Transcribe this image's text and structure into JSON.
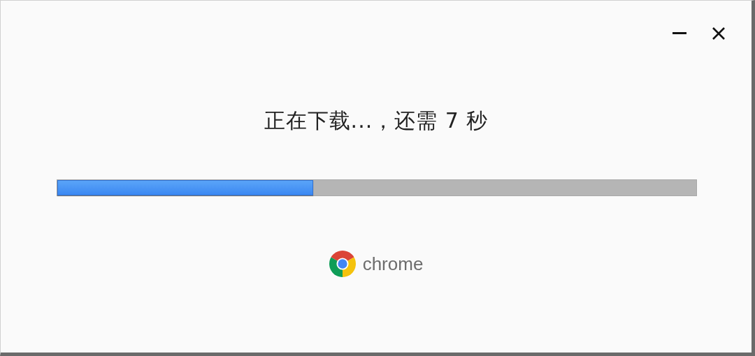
{
  "status": {
    "message": "正在下载...，还需 7 秒"
  },
  "progress": {
    "level": 0.4
  },
  "brand": {
    "name": "chrome"
  }
}
